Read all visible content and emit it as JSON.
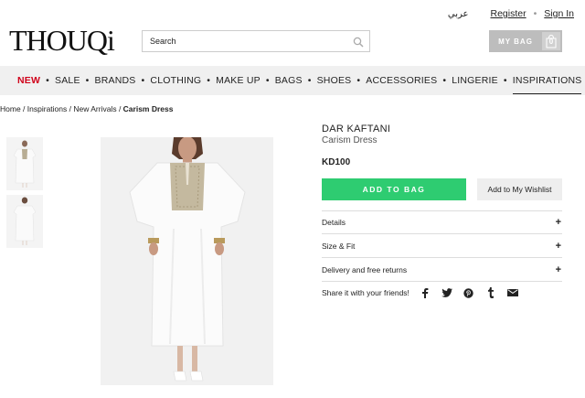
{
  "header": {
    "language_link": "عربي",
    "register": "Register",
    "separator": "•",
    "sign_in": "Sign In",
    "logo": "THOUQi",
    "search_placeholder": "Search",
    "bag_label": "MY BAG",
    "bag_count": "0"
  },
  "nav": {
    "items": [
      "NEW",
      "SALE",
      "BRANDS",
      "CLOTHING",
      "MAKE UP",
      "BAGS",
      "SHOES",
      "ACCESSORIES",
      "LINGERIE",
      "INSPIRATIONS"
    ],
    "separator": "•",
    "active": "INSPIRATIONS"
  },
  "breadcrumb": {
    "home": "Home",
    "inspirations": "Inspirations",
    "new_arrivals": "New Arrivals",
    "current": "Carism Dress",
    "separator": " / "
  },
  "product": {
    "brand": "DAR KAFTANI",
    "name": "Carism Dress",
    "price": "KD100",
    "add_to_bag": "ADD TO BAG",
    "add_to_wishlist": "Add to My Wishlist",
    "accordions": [
      {
        "label": "Details",
        "icon": "+"
      },
      {
        "label": "Size & Fit",
        "icon": "+"
      },
      {
        "label": "Delivery and free returns",
        "icon": "+"
      }
    ],
    "share_label": "Share it with your friends!",
    "share_icons": [
      "facebook-icon",
      "twitter-icon",
      "pinterest-icon",
      "tumblr-icon",
      "email-icon"
    ]
  },
  "colors": {
    "accent_green": "#2ecc71",
    "new_red": "#d0021b",
    "nav_bg": "#f0f0f0",
    "bag_bg": "#bdbdbd"
  }
}
